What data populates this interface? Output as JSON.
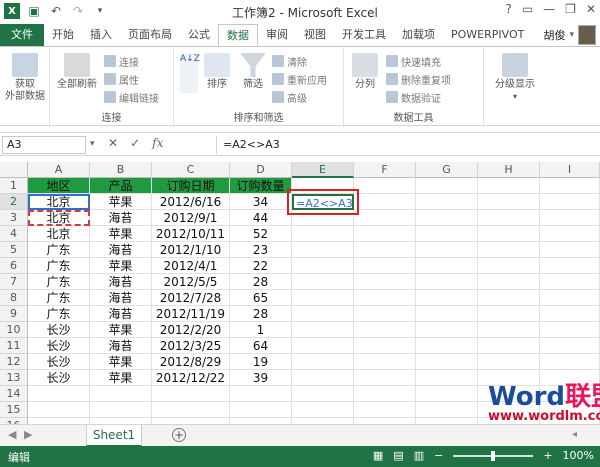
{
  "window": {
    "title": "工作簿2 - Microsoft Excel"
  },
  "tabs": [
    "文件",
    "开始",
    "插入",
    "页面布局",
    "公式",
    "数据",
    "审阅",
    "视图",
    "开发工具",
    "加载项",
    "POWERPIVOT"
  ],
  "user": "胡俊",
  "ribbon": {
    "external": "获取\n外部数据",
    "refresh": "全部刷新",
    "conn_small": [
      "连接",
      "属性",
      "编辑链接"
    ],
    "conn_label": "连接",
    "sort_az": "A↓Z",
    "sort": "排序",
    "filter": "筛选",
    "filter_small": [
      "清除",
      "重新应用",
      "高级"
    ],
    "sortfilter_label": "排序和筛选",
    "split": "分列",
    "tools_small": [
      "快速填充",
      "删除重复项",
      "数据验证"
    ],
    "tools_label": "数据工具",
    "outline": "分级显示"
  },
  "formula_bar": {
    "name_box": "A3",
    "formula": "=A2<>A3"
  },
  "columns": [
    "A",
    "B",
    "C",
    "D",
    "E",
    "F",
    "G",
    "H",
    "I"
  ],
  "rows": [
    "1",
    "2",
    "3",
    "4",
    "5",
    "6",
    "7",
    "8",
    "9",
    "10",
    "11",
    "12",
    "13",
    "14",
    "15",
    "16"
  ],
  "table": {
    "headers": [
      "地区",
      "产品",
      "订购日期",
      "订购数量"
    ],
    "data": [
      [
        "北京",
        "苹果",
        "2012/6/16",
        "34"
      ],
      [
        "北京",
        "海苔",
        "2012/9/1",
        "44"
      ],
      [
        "北京",
        "苹果",
        "2012/10/11",
        "52"
      ],
      [
        "广东",
        "海苔",
        "2012/1/10",
        "23"
      ],
      [
        "广东",
        "苹果",
        "2012/4/1",
        "22"
      ],
      [
        "广东",
        "海苔",
        "2012/5/5",
        "28"
      ],
      [
        "广东",
        "海苔",
        "2012/7/28",
        "65"
      ],
      [
        "广东",
        "海苔",
        "2012/11/19",
        "28"
      ],
      [
        "长沙",
        "苹果",
        "2012/2/20",
        "1"
      ],
      [
        "长沙",
        "海苔",
        "2012/3/25",
        "64"
      ],
      [
        "长沙",
        "苹果",
        "2012/8/29",
        "19"
      ],
      [
        "长沙",
        "苹果",
        "2012/12/22",
        "39"
      ]
    ]
  },
  "edit_cell": "=A2<>A3",
  "watermark": {
    "brand_a": "Word",
    "brand_b": "联盟",
    "url": "www.wordlm.com"
  },
  "sheet_tab": "Sheet1",
  "status": {
    "mode": "编辑",
    "zoom": "100%"
  }
}
